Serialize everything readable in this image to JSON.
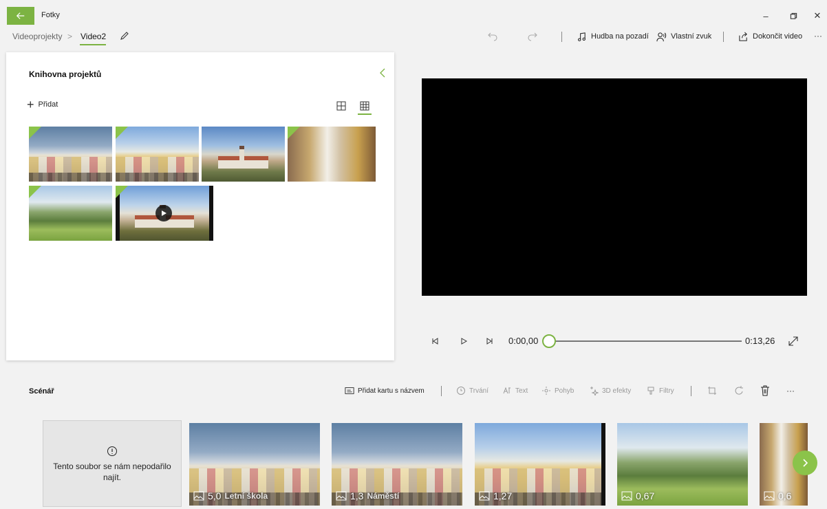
{
  "app": {
    "title": "Fotky"
  },
  "window": {
    "minimize": "–",
    "close": "✕",
    "more": "···"
  },
  "breadcrumb": {
    "parent": "Videoprojekty",
    "separator": ">",
    "current": "Video2"
  },
  "commands": {
    "background_music": "Hudba na pozadí",
    "custom_audio": "Vlastní zvuk",
    "finish_video": "Dokončit video"
  },
  "library": {
    "title": "Knihovna projektů",
    "add_label": "Přidat",
    "items": [
      {
        "kind": "photo",
        "used": true
      },
      {
        "kind": "photo",
        "used": true
      },
      {
        "kind": "photo",
        "used": false
      },
      {
        "kind": "photo",
        "used": true
      },
      {
        "kind": "photo",
        "used": true
      },
      {
        "kind": "video",
        "used": true
      }
    ]
  },
  "player": {
    "current_time": "0:00,00",
    "total_time": "0:13,26",
    "progress": 0.0
  },
  "storyboard": {
    "title": "Scénář",
    "tools": {
      "add_title_card": "Přidat kartu s názvem",
      "duration": "Trvání",
      "text": "Text",
      "motion": "Pohyb",
      "effects_3d": "3D efekty",
      "filters": "Filtry",
      "more": "···"
    },
    "missing_message": "Tento soubor se nám nepodařilo najít.",
    "cards": [
      {
        "duration": "5,0",
        "caption": "Letní škola"
      },
      {
        "duration": "1,3",
        "caption": "Náměstí"
      },
      {
        "duration": "1,27",
        "caption": ""
      },
      {
        "duration": "0,67",
        "caption": ""
      },
      {
        "duration": "0,6",
        "caption": ""
      }
    ]
  },
  "colors": {
    "accent": "#7cb342",
    "preview_bg": "#000000"
  }
}
